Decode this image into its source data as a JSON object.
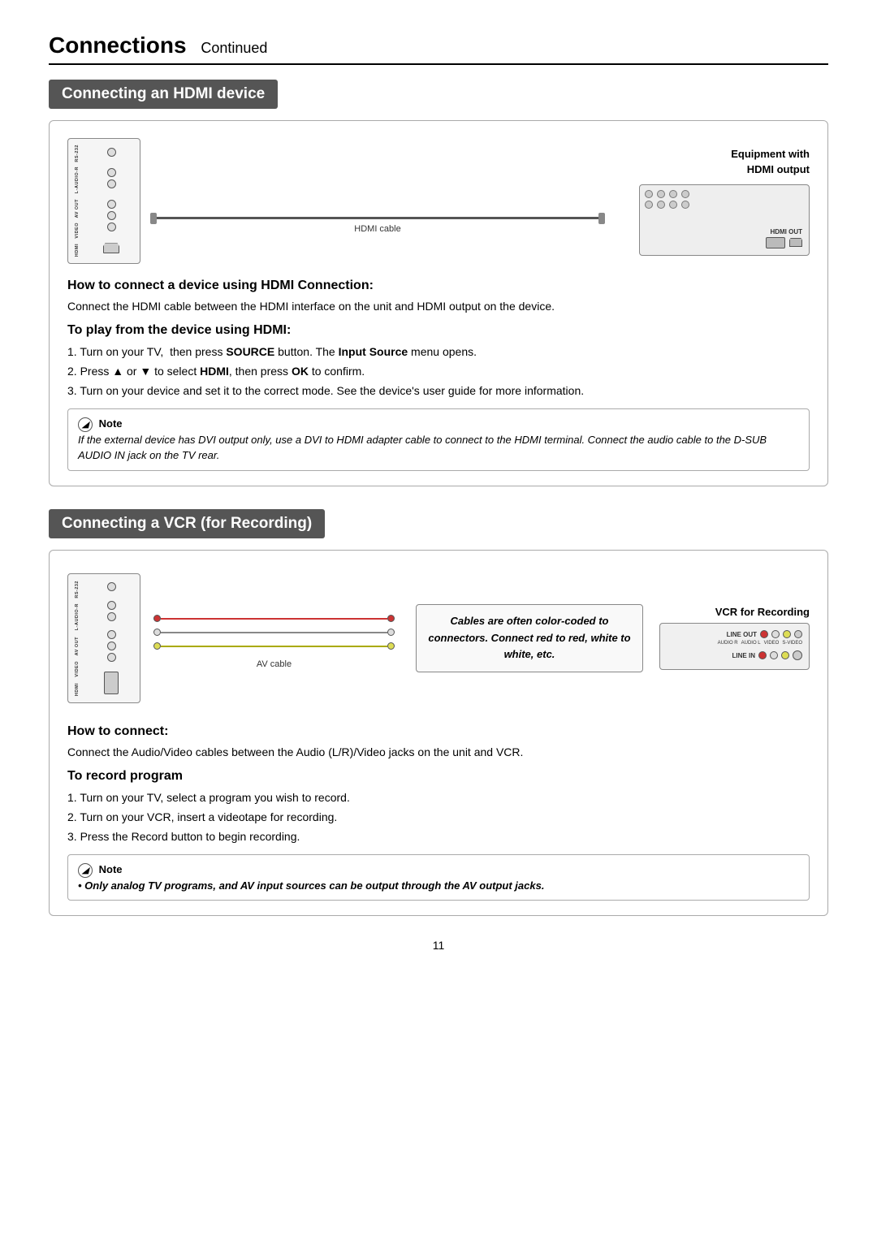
{
  "page": {
    "title": "Connections",
    "title_continued": "Continued",
    "page_number": "11"
  },
  "section1": {
    "header": "Connecting an HDMI device",
    "equipment_label_line1": "Equipment with",
    "equipment_label_line2": "HDMI output",
    "cable_label": "HDMI cable",
    "hdmi_out_label": "HDMI OUT",
    "how_to_connect_heading": "How to connect a device using HDMI Connection:",
    "how_to_connect_text": "Connect the HDMI cable between the HDMI interface on the unit and HDMI output on the device.",
    "to_play_heading": "To play from the device using HDMI:",
    "steps": [
      "1. Turn on your TV,  then press SOURCE button. The Input Source menu opens.",
      "2. Press ▲ or ▼ to select HDMI, then press OK to confirm.",
      "3. Turn on your device and set it to the correct mode. See the device's user guide for more information."
    ],
    "note_label": "Note",
    "note_text": "If the external device has DVI output only, use a DVI to HDMI adapter cable to connect to the HDMI terminal. Connect the audio cable to the D-SUB AUDIO IN jack on the TV rear."
  },
  "section2": {
    "header": "Connecting a VCR (for Recording)",
    "callout_text": "Cables are often color-coded to connectors. Connect red to red, white to white, etc.",
    "vcr_label": "VCR for Recording",
    "line_out_label": "LINE\nOUT",
    "line_in_label": "LINE\nIN",
    "av_cable_label": "AV cable",
    "how_to_connect_heading": "How to connect:",
    "how_to_connect_text": "Connect the Audio/Video cables between the Audio (L/R)/Video jacks on the unit and VCR.",
    "to_record_heading": "To record program",
    "record_steps": [
      "1. Turn on your TV, select a program you wish to record.",
      "2. Turn on your VCR, insert a videotape for recording.",
      "3. Press the Record button to begin recording."
    ],
    "note_label": "Note",
    "note_text": "• Only analog TV programs, and AV input sources can be output through the AV output jacks.",
    "port_labels": {
      "rs232": "RS-232",
      "l_audio_r": "L-AUDIO-R",
      "av_out": "AV OUT",
      "video": "VIDEO",
      "hdmi": "HDMI"
    },
    "vcr_port_labels": {
      "audio_r": "AUDIO R",
      "audio_l": "AUDIO L",
      "video": "VIDEO",
      "s_video": "S-VIDEO"
    }
  }
}
